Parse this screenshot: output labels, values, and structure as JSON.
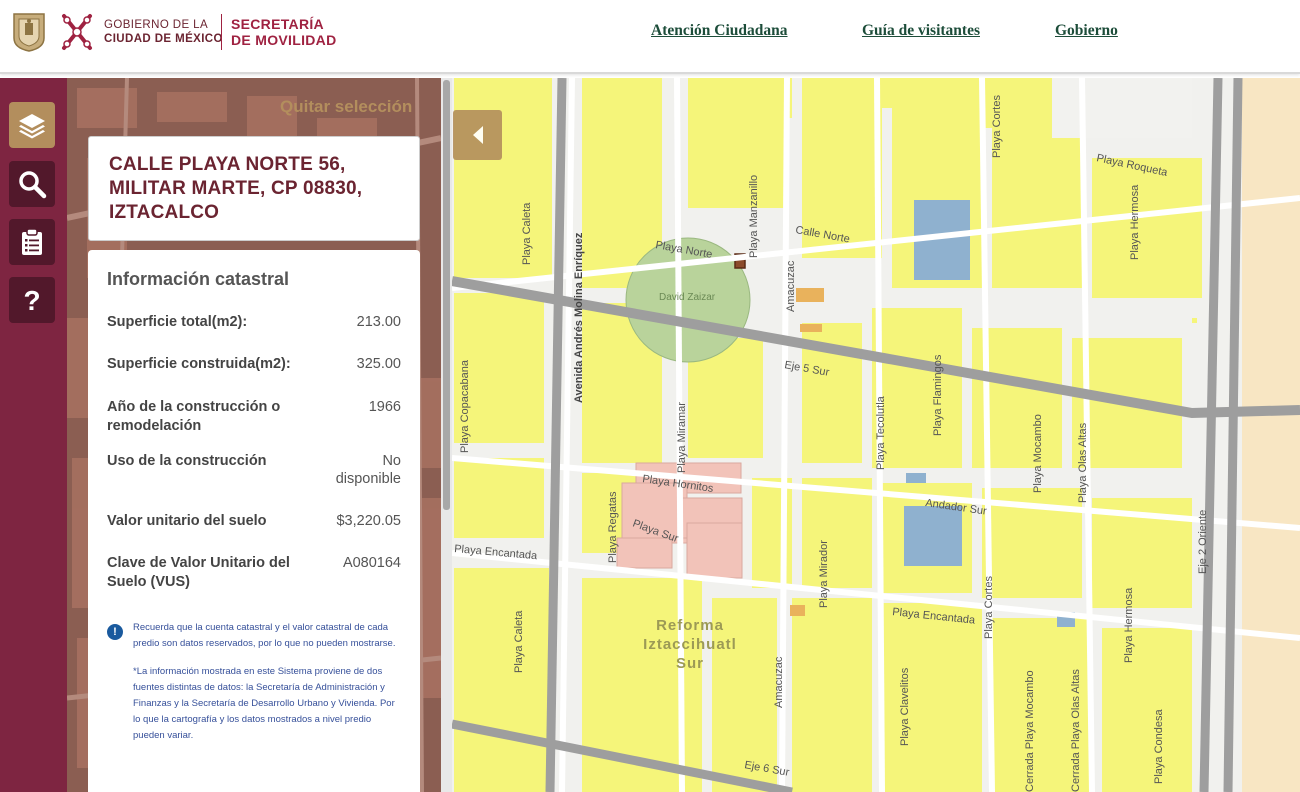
{
  "header": {
    "gov_line1": "GOBIERNO DE LA",
    "gov_line2": "CIUDAD DE MÉXICO",
    "sec_line1": "SECRETARÍA",
    "sec_line2": "DE MOVILIDAD",
    "nav": [
      "Atención Ciudadana",
      "Guía de visitantes",
      "Gobierno"
    ]
  },
  "rail": {
    "buttons": [
      "layers-icon",
      "search-icon",
      "clipboard-icon",
      "help-icon"
    ],
    "active": "layers-icon"
  },
  "panel": {
    "clear_selection": "Quitar selección",
    "address_line1": "CALLE PLAYA NORTE 56,",
    "address_line2": "MILITAR MARTE, CP 08830,",
    "address_line3": "IZTACALCO",
    "info_title": "Información catastral",
    "rows": [
      {
        "label": "Superficie total(m2):",
        "value": "213.00"
      },
      {
        "label": "Superficie construida(m2):",
        "value": "325.00"
      },
      {
        "label": "Año de la construcción o remodelación",
        "value": "1966"
      },
      {
        "label": "Uso de la construcción",
        "value": "No disponible"
      },
      {
        "label": "Valor unitario del suelo",
        "value": "$3,220.05"
      },
      {
        "label": "Clave de Valor Unitario del Suelo (VUS)",
        "value": "A080164"
      }
    ],
    "notice": "Recuerda que la cuenta catastral y el valor catastral de cada predio son datos reservados, por lo que no pueden mostrarse.",
    "note": "*La información mostrada en este Sistema proviene de dos fuentes distintas de datos: la Secretaría de Administración y Finanzas y la Secretaría de Desarrollo Urbano y Vivienda. Por lo que la cartografía y los datos mostrados a nivel predio pueden variar."
  },
  "map": {
    "labels": {
      "playa_norte": "Playa Norte",
      "calle_norte": "Calle Norte",
      "playa_roqueta": "Playa Roqueta",
      "playa_cortes_top": "Playa Cortes",
      "playa_hermosa_top": "Playa Hermosa",
      "playa_manzanillo": "Playa Manzanillo",
      "amacuzac_top": "Amacuzac",
      "playa_caleta_top": "Playa Caleta",
      "avenida": "Avenida Andrés Molina Enríquez",
      "david_zaizar": "David Zaizar",
      "eje5": "Eje 5 Sur",
      "playa_copacabana": "Playa Copacabana",
      "playa_miramar": "Playa Miramar",
      "playa_tecolutla": "Playa Tecolutla",
      "playa_flamingos": "Playa Flamingos",
      "playa_mocambo_top": "Playa Mocambo",
      "playa_olas_altas_top": "Playa Olas Altas",
      "eje2": "Eje 2 Oriente",
      "playa_hornitos": "Playa Hornitos",
      "playa_regatas": "Playa Regatas",
      "playa_sur": "Playa Sur",
      "andador_sur": "Andador Sur",
      "playa_encantada_left": "Playa Encantada",
      "playa_mirador": "Playa Mirador",
      "playa_cortes_bottom": "Playa Cortes",
      "playa_encantada_right": "Playa Encantada",
      "playa_hermosa_bottom": "Playa Hermosa",
      "neighborhood_l1": "Reforma",
      "neighborhood_l2": "Iztaccihuatl",
      "neighborhood_l3": "Sur",
      "playa_caleta_bottom": "Playa Caleta",
      "amacuzac_bottom": "Amacuzac",
      "playa_clavelitos": "Playa Clavelitos",
      "cerrada_mocambo": "Cerrada Playa Mocambo",
      "cerrada_olas_altas": "Cerrada Playa Olas Altas",
      "playa_condesa": "Playa Condesa",
      "eje6": "Eje 6 Sur"
    },
    "colors": {
      "block": "#f5f57a",
      "park": "#b9d39b",
      "public": "#8fb1cf",
      "commercial": "#e9b25c",
      "housing": "#f2c3b9",
      "selected": "#8b4b2b",
      "road_major": "#9e9e9e"
    }
  }
}
